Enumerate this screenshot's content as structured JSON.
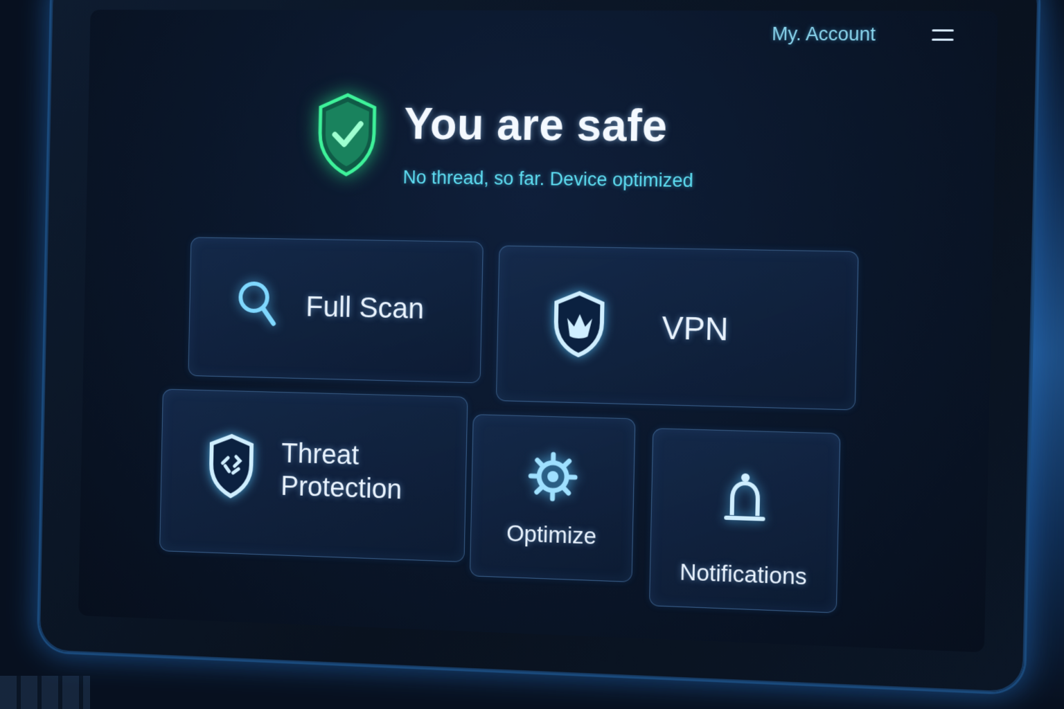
{
  "topbar": {
    "account_label": "My. Account",
    "menu_icon": "hamburger-menu-icon"
  },
  "status": {
    "icon": "shield-check-icon",
    "title": "You are safe",
    "subtitle": "No thread, so far. Device optimized",
    "accent_color": "#2fe08a"
  },
  "tiles": {
    "full_scan": {
      "label": "Full Scan",
      "icon": "search-icon"
    },
    "vpn": {
      "label": "VPN",
      "icon": "shield-icon"
    },
    "threat_protection": {
      "label_line1": "Threat",
      "label_line2": "Protection",
      "icon": "threat-shield-icon"
    },
    "optimize": {
      "label": "Optimize",
      "icon": "gear-icon"
    },
    "notifications": {
      "label": "Notifications",
      "icon": "bell-icon"
    }
  },
  "colors": {
    "background": "#0a1629",
    "accent_blue": "#5fd0ff",
    "text_primary": "#eaf4ff",
    "subtitle_cyan": "#5fe0f4"
  }
}
